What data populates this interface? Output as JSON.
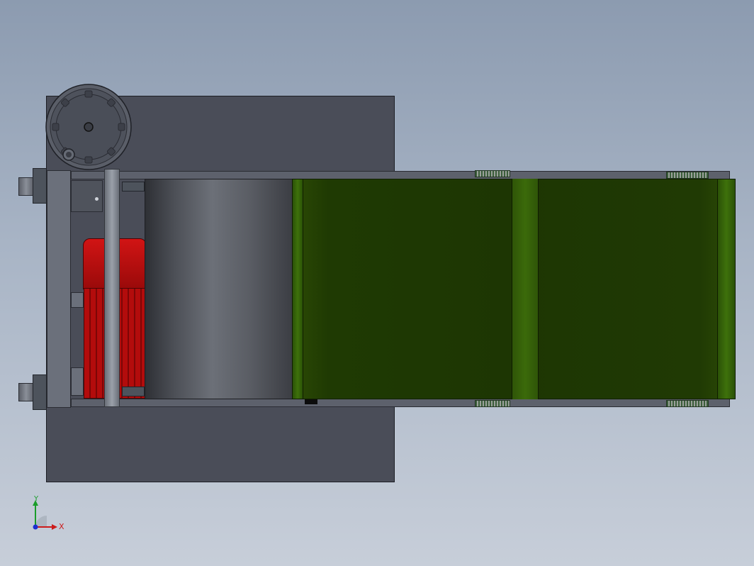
{
  "viewport": {
    "background_top": "#8c9bb0",
    "background_bottom": "#c7ced9"
  },
  "model": {
    "belt_color": "#1d3603",
    "motor_color": "#b30c0c",
    "frame_color": "#4a4d58"
  },
  "triad": {
    "x_label": "X",
    "y_label": "Y",
    "x_color": "#cc1b1b",
    "y_color": "#1a9d2a",
    "z_color": "#1d2fd0"
  }
}
